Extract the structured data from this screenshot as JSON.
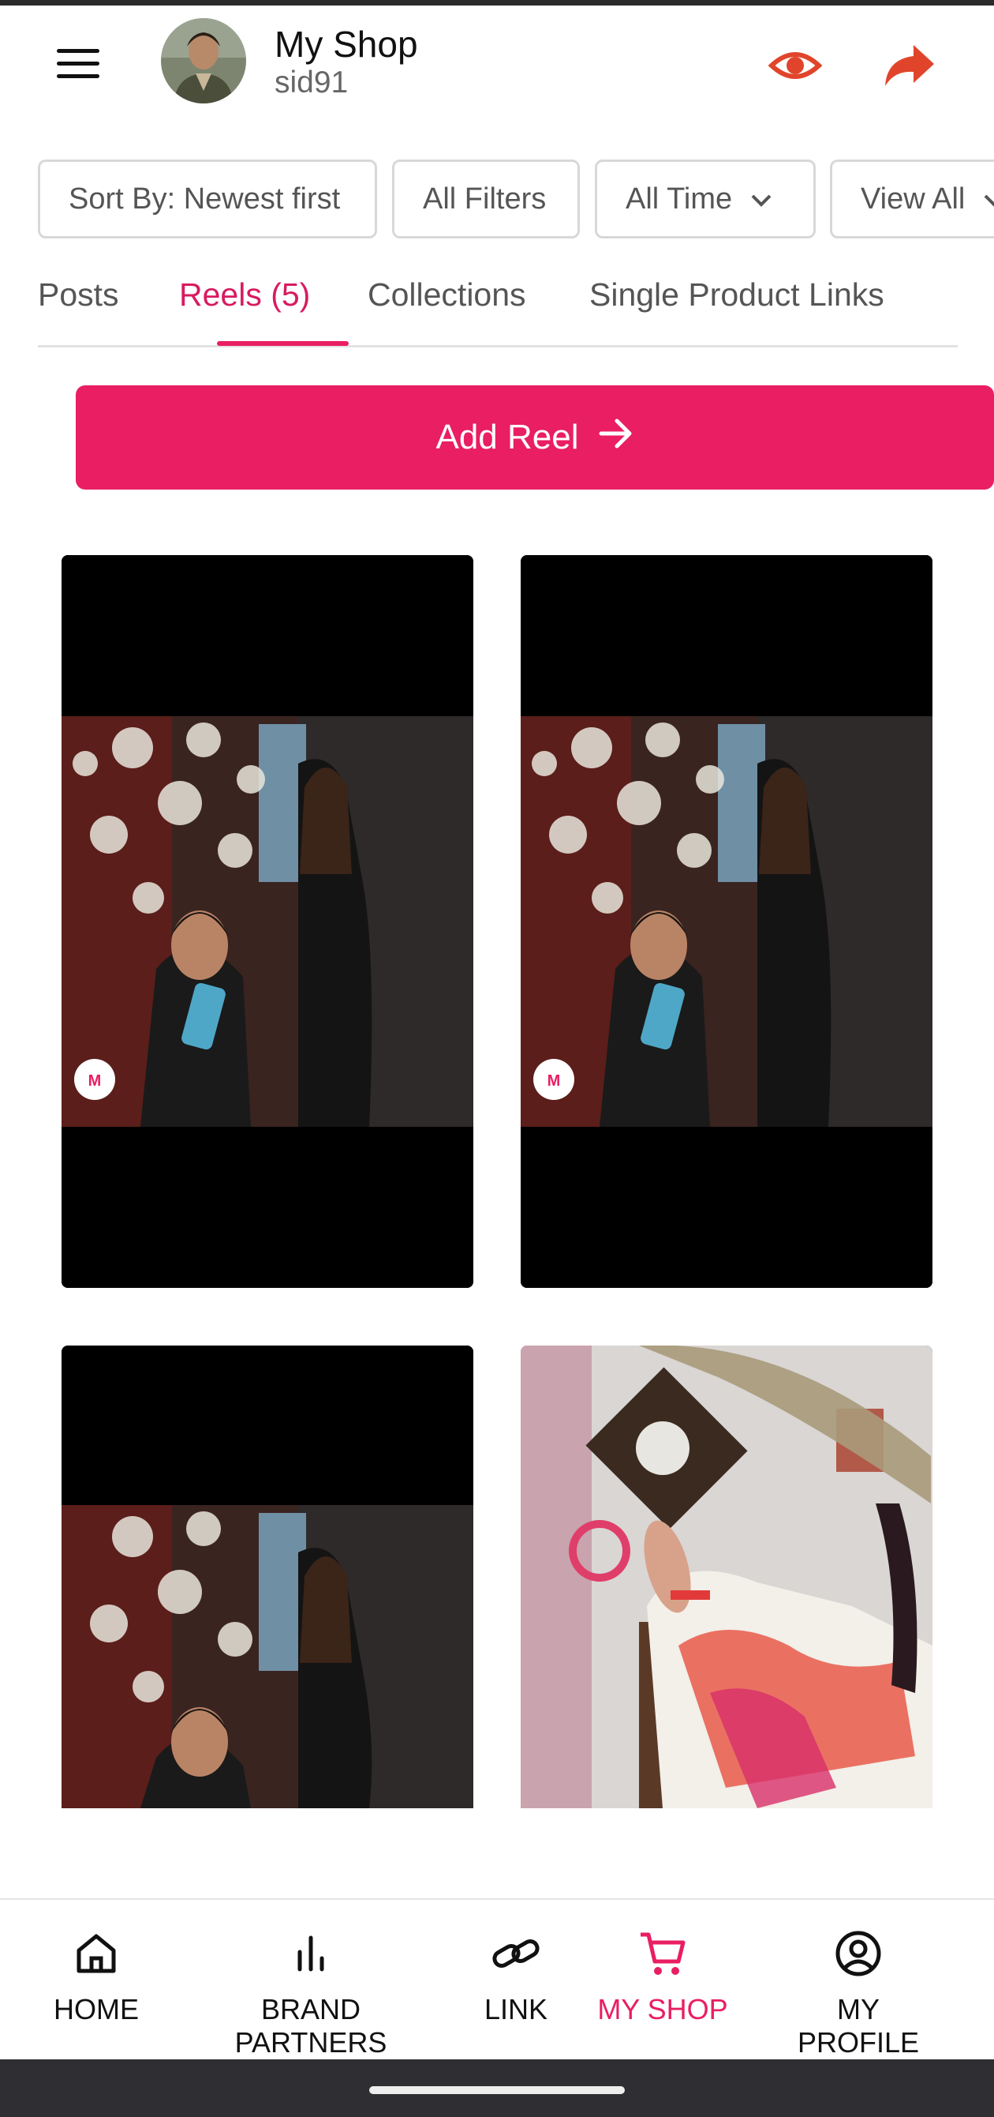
{
  "header": {
    "title": "My Shop",
    "username": "sid91",
    "menu_icon": "hamburger-menu-icon",
    "preview_icon": "eye-icon",
    "share_icon": "share-icon",
    "accent_color": "#e0452b"
  },
  "filters": {
    "sort": "Sort By: Newest first",
    "all_filters": "All Filters",
    "time": "All Time",
    "view": "View All"
  },
  "tabs": [
    {
      "label": "Posts",
      "active": false
    },
    {
      "label": "Reels (5)",
      "active": true
    },
    {
      "label": "Collections",
      "active": false
    },
    {
      "label": "Single Product Links",
      "active": false
    }
  ],
  "add_reel": {
    "label": "Add Reel",
    "icon": "arrow-right-icon",
    "color": "#e91e63"
  },
  "reels": [
    {
      "badge": "Myntra",
      "kind": "party-scene"
    },
    {
      "badge": "Myntra",
      "kind": "party-scene"
    },
    {
      "badge": "",
      "kind": "party-scene"
    },
    {
      "badge": "",
      "kind": "home-scene"
    }
  ],
  "bottom_nav": [
    {
      "label": "HOME",
      "icon": "home-icon",
      "active": false
    },
    {
      "label": "BRAND PARTNERS",
      "icon": "bar-chart-icon",
      "active": false
    },
    {
      "label": "LINK",
      "icon": "link-icon",
      "active": false
    },
    {
      "label": "MY SHOP",
      "icon": "cart-icon",
      "active": true
    },
    {
      "label": "MY PROFILE",
      "icon": "user-circle-icon",
      "active": false
    }
  ],
  "colors": {
    "brand_pink": "#e91e63",
    "active_text": "#d81b60"
  }
}
